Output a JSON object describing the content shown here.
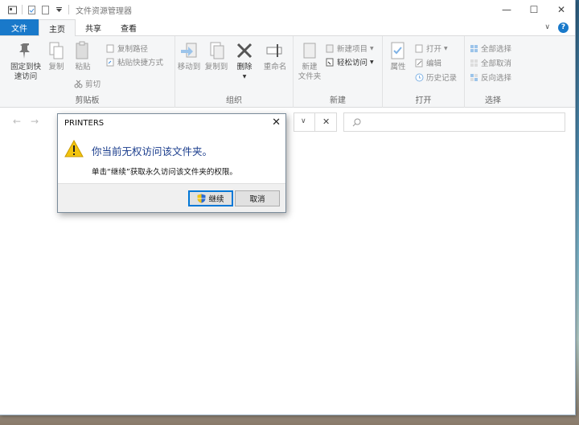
{
  "window": {
    "title": "文件资源管理器"
  },
  "tabs": [
    {
      "label": "文件"
    },
    {
      "label": "主页"
    },
    {
      "label": "共享"
    },
    {
      "label": "查看"
    }
  ],
  "ribbon": {
    "clipboard": {
      "label": "剪贴板",
      "pin": "固定到快\n速访问",
      "copy": "复制",
      "paste": "粘贴",
      "copy_path": "复制路径",
      "paste_shortcut": "粘贴快捷方式",
      "cut": "剪切"
    },
    "organize": {
      "label": "组织",
      "move_to": "移动到",
      "copy_to": "复制到",
      "delete": "删除",
      "rename": "重命名"
    },
    "new": {
      "label": "新建",
      "new_folder": "新建\n文件夹",
      "new_item": "新建项目",
      "easy_access": "轻松访问"
    },
    "open": {
      "label": "打开",
      "properties": "属性",
      "open": "打开",
      "edit": "编辑",
      "history": "历史记录"
    },
    "select": {
      "label": "选择",
      "select_all": "全部选择",
      "select_none": "全部取消",
      "invert": "反向选择"
    }
  },
  "dialog": {
    "title": "PRINTERS",
    "main_text": "你当前无权访问该文件夹。",
    "sub_text": "单击“继续”获取永久访问该文件夹的权限。",
    "continue_label": "继续",
    "cancel_label": "取消"
  },
  "colors": {
    "accent": "#1979ca",
    "dialog_heading": "#1a3c8c",
    "warning": "#f2c40f"
  }
}
